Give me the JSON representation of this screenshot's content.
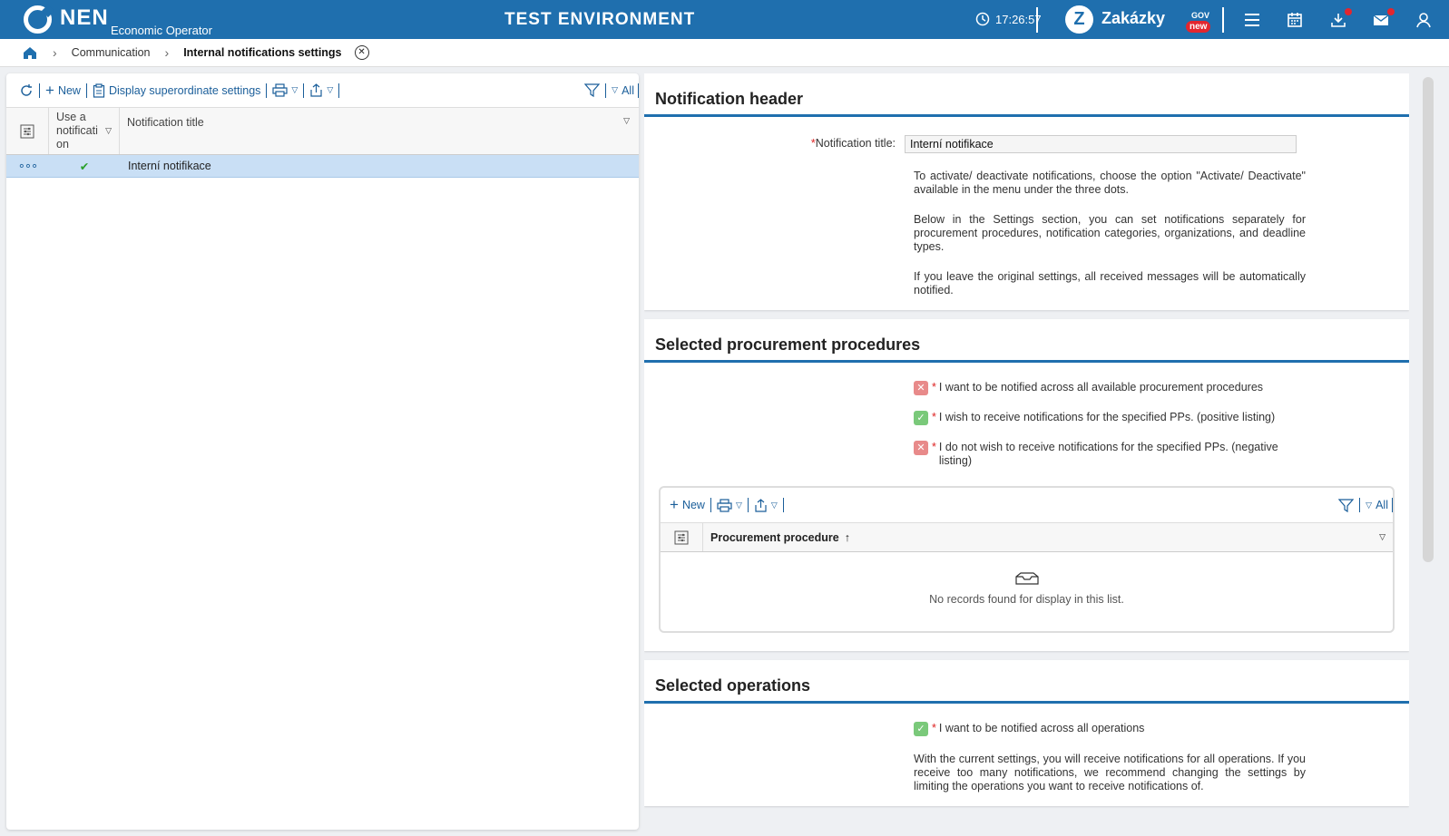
{
  "header": {
    "logo": "NEN",
    "logo_subtitle": "Economic Operator",
    "environment": "TEST ENVIRONMENT",
    "clock": "17:26:57",
    "zakazky": "Zakázky",
    "zakazky_gov": "GOV",
    "zakazky_badge": "new"
  },
  "breadcrumb": {
    "items": [
      "Communication"
    ],
    "current": "Internal notifications settings"
  },
  "left_toolbar": {
    "new_label": "New",
    "superordinate_label": "Display superordinate settings",
    "filter_all_label": "All"
  },
  "grid": {
    "columns": [
      "Use a notificati on",
      "Notification title"
    ],
    "rows": [
      {
        "title": "Interní notifikace",
        "active": true
      }
    ]
  },
  "notification_header": {
    "title": "Notification header",
    "field_label": "Notification title:",
    "field_value": "Interní notifikace",
    "info1": "To activate/ deactivate notifications, choose the option \"Activate/ Deactivate\" available in the menu under the three dots.",
    "info2": "Below in the Settings section, you can set notifications separately for procurement procedures, notification categories, organizations, and deadline types.",
    "info3": "If you leave the original settings, all received messages will be automatically notified."
  },
  "procedures": {
    "title": "Selected procurement procedures",
    "options": [
      {
        "checked": false,
        "label": "I want to be notified across all available procurement procedures"
      },
      {
        "checked": true,
        "label": "I wish to receive notifications for the specified PPs. (positive listing)"
      },
      {
        "checked": false,
        "label": "I do not wish to receive notifications for the specified PPs. (negative listing)"
      }
    ],
    "sub_new_label": "New",
    "sub_all_label": "All",
    "sub_column": "Procurement procedure",
    "empty_text": "No records found for display in this list."
  },
  "operations": {
    "title": "Selected operations",
    "option_label": "I want to be notified across all operations",
    "info": "With the current settings, you will receive notifications for all operations. If you receive too many notifications, we recommend changing the settings by limiting the operations you want to receive notifications of."
  }
}
